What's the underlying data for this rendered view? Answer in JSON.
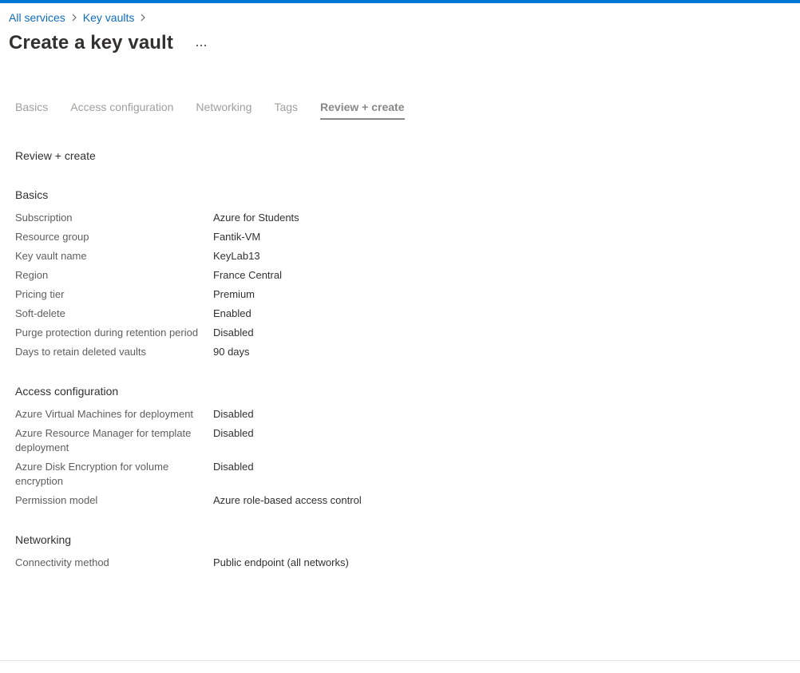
{
  "colors": {
    "accent": "#0078d4",
    "link": "#0f6cbd"
  },
  "breadcrumb": {
    "items": [
      {
        "label": "All services"
      },
      {
        "label": "Key vaults"
      }
    ],
    "separator_icon": "chevron-right-icon"
  },
  "page": {
    "title": "Create a key vault",
    "more_icon": "ellipsis-icon",
    "more_label": "···"
  },
  "tabs": [
    {
      "label": "Basics",
      "active": false
    },
    {
      "label": "Access configuration",
      "active": false
    },
    {
      "label": "Networking",
      "active": false
    },
    {
      "label": "Tags",
      "active": false
    },
    {
      "label": "Review + create",
      "active": true
    }
  ],
  "review": {
    "heading": "Review + create",
    "basics": {
      "heading": "Basics",
      "rows": [
        {
          "label": "Subscription",
          "value": "Azure for Students"
        },
        {
          "label": "Resource group",
          "value": "Fantik-VM"
        },
        {
          "label": "Key vault name",
          "value": "KeyLab13"
        },
        {
          "label": "Region",
          "value": "France Central"
        },
        {
          "label": "Pricing tier",
          "value": "Premium"
        },
        {
          "label": "Soft-delete",
          "value": "Enabled"
        },
        {
          "label": "Purge protection during retention period",
          "value": "Disabled"
        },
        {
          "label": "Days to retain deleted vaults",
          "value": "90 days"
        }
      ]
    },
    "access": {
      "heading": "Access configuration",
      "rows": [
        {
          "label": "Azure Virtual Machines for deployment",
          "value": "Disabled"
        },
        {
          "label": "Azure Resource Manager for template deployment",
          "value": "Disabled"
        },
        {
          "label": "Azure Disk Encryption for volume encryption",
          "value": "Disabled"
        },
        {
          "label": "Permission model",
          "value": "Azure role-based access control"
        }
      ]
    },
    "networking": {
      "heading": "Networking",
      "rows": [
        {
          "label": "Connectivity method",
          "value": "Public endpoint (all networks)"
        }
      ]
    }
  }
}
